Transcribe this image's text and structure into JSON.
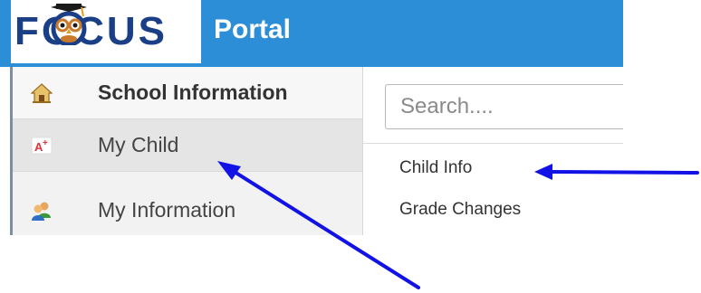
{
  "header": {
    "logo_text": "FOCUS",
    "portal_label": "Portal",
    "bar_color": "#2d8ed8"
  },
  "sidebar": {
    "items": [
      {
        "label": "School Information",
        "icon": "home-icon",
        "state": "active"
      },
      {
        "label": "My Child",
        "icon": "a-plus-grade-icon",
        "state": "hover"
      },
      {
        "label": "My Information",
        "icon": "users-icon",
        "state": "normal"
      }
    ]
  },
  "panel": {
    "search_placeholder": "Search....",
    "items": [
      {
        "label": "Child Info"
      },
      {
        "label": "Grade Changes"
      }
    ]
  },
  "annotations": {
    "arrow_color": "#1212e6",
    "arrows": [
      "arrow-to-my-child",
      "arrow-to-child-info"
    ]
  }
}
